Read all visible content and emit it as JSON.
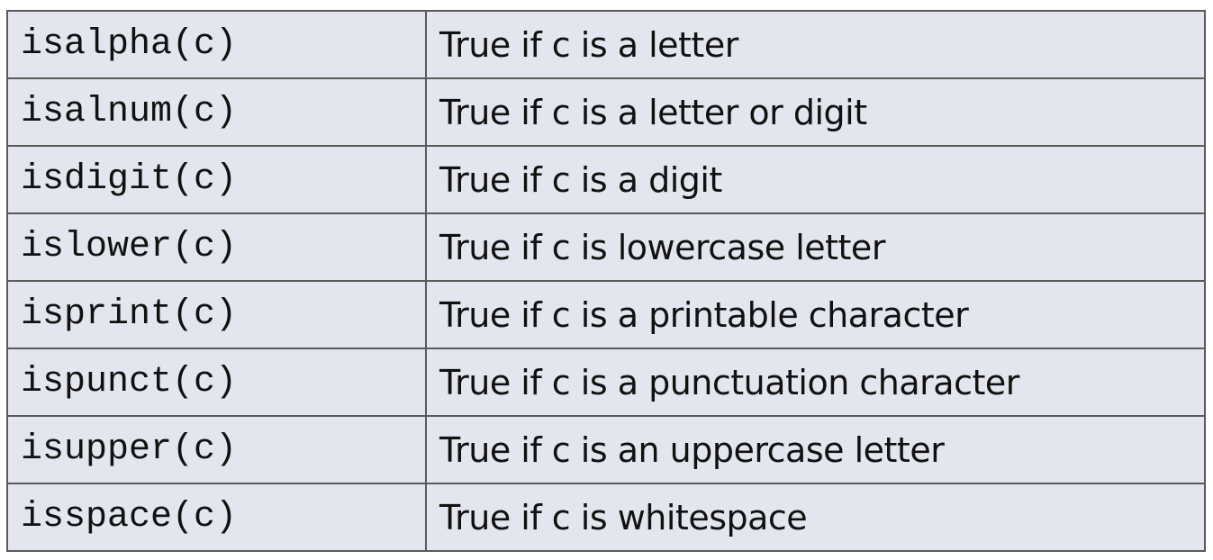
{
  "table": {
    "rows": [
      {
        "func": "isalpha(c)",
        "desc": "True if c is a letter"
      },
      {
        "func": "isalnum(c)",
        "desc": "True if c is a letter or digit"
      },
      {
        "func": "isdigit(c)",
        "desc": "True if c is a digit"
      },
      {
        "func": "islower(c)",
        "desc": "True if c is lowercase letter"
      },
      {
        "func": "isprint(c)",
        "desc": "True if c is a printable character"
      },
      {
        "func": "ispunct(c)",
        "desc": "True if c is a punctuation character"
      },
      {
        "func": "isupper(c)",
        "desc": "True if c is an uppercase letter"
      },
      {
        "func": "isspace(c)",
        "desc": "True if c is whitespace"
      }
    ]
  },
  "colors": {
    "cell_background": "#e4e6ef",
    "border": "#5a5a5a",
    "text": "#111111"
  }
}
